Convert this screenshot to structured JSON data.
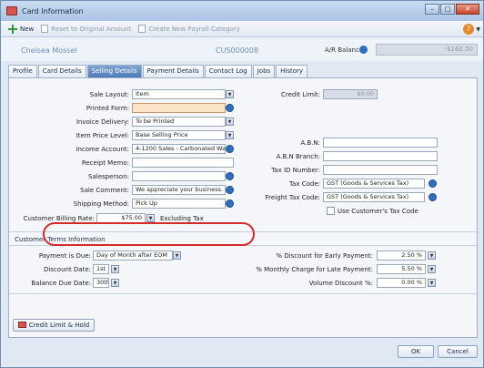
{
  "window": {
    "title": "Card Information"
  },
  "toolbar": {
    "new_label": "New",
    "reset_label": "Reset to Original Amount",
    "create_payroll_label": "Create New Payroll Category"
  },
  "header": {
    "card_name": "Chelsea Mossel",
    "card_id": "CUS000008",
    "ar_balance_label": "A/R Balance:",
    "ar_balance_value": "-$162.50"
  },
  "tabs": [
    "Profile",
    "Card Details",
    "Selling Details",
    "Payment Details",
    "Contact Log",
    "Jobs",
    "History"
  ],
  "active_tab": "Selling Details",
  "selling": {
    "sale_layout_label": "Sale Layout:",
    "sale_layout_value": "Item",
    "printed_form_label": "Printed Form:",
    "printed_form_value": "",
    "invoice_delivery_label": "Invoice Delivery:",
    "invoice_delivery_value": "To be Printed",
    "item_price_level_label": "Item Price Level:",
    "item_price_level_value": "Base Selling Price",
    "income_account_label": "Income Account:",
    "income_account_value": "4-1200 Sales - Carbonated Wat",
    "receipt_memo_label": "Receipt Memo:",
    "receipt_memo_value": "",
    "salesperson_label": "Salesperson:",
    "salesperson_value": "",
    "sale_comment_label": "Sale Comment:",
    "sale_comment_value": "We appreciate your business.",
    "shipping_method_label": "Shipping Method:",
    "shipping_method_value": "Pick Up",
    "billing_rate_label": "Customer Billing Rate:",
    "billing_rate_value": "$75.00",
    "billing_rate_tax": "Excluding Tax"
  },
  "right": {
    "credit_limit_label": "Credit Limit:",
    "credit_limit_value": "$0.00",
    "abn_label": "A.B.N:",
    "abn_value": "",
    "abn_branch_label": "A.B.N Branch:",
    "abn_branch_value": "",
    "tax_id_label": "Tax ID Number:",
    "tax_id_value": "",
    "tax_code_label": "Tax Code:",
    "tax_code_value": "GST (Goods & Services Tax)",
    "freight_tax_code_label": "Freight Tax Code:",
    "freight_tax_code_value": "GST (Goods & Services Tax)",
    "use_customer_tax_label": "Use Customer's Tax Code"
  },
  "terms": {
    "section_title": "Customer Terms Information",
    "payment_due_label": "Payment is Due:",
    "payment_due_value": "Day of Month after EOM",
    "discount_date_label": "Discount Date:",
    "discount_date_value": "1st",
    "balance_due_label": "Balance Due Date:",
    "balance_due_value": "30th",
    "early_discount_label": "% Discount for Early Payment:",
    "early_discount_value": "2.50 %",
    "late_charge_label": "% Monthly Charge for Late Payment:",
    "late_charge_value": "5.50 %",
    "volume_discount_label": "Volume Discount %:",
    "volume_discount_value": "0.00 %"
  },
  "buttons": {
    "credit_hold": "Credit Limit & Hold",
    "ok": "OK",
    "cancel": "Cancel"
  },
  "glyphs": {
    "help": "?",
    "dropdown": "▼",
    "minimize": "–",
    "maximize": "□",
    "close": "✕"
  },
  "colors": {
    "active_tab": "#4f7bb7",
    "highlight_circle": "#d62b2b",
    "printed_form_fill": "#fde4c8"
  }
}
